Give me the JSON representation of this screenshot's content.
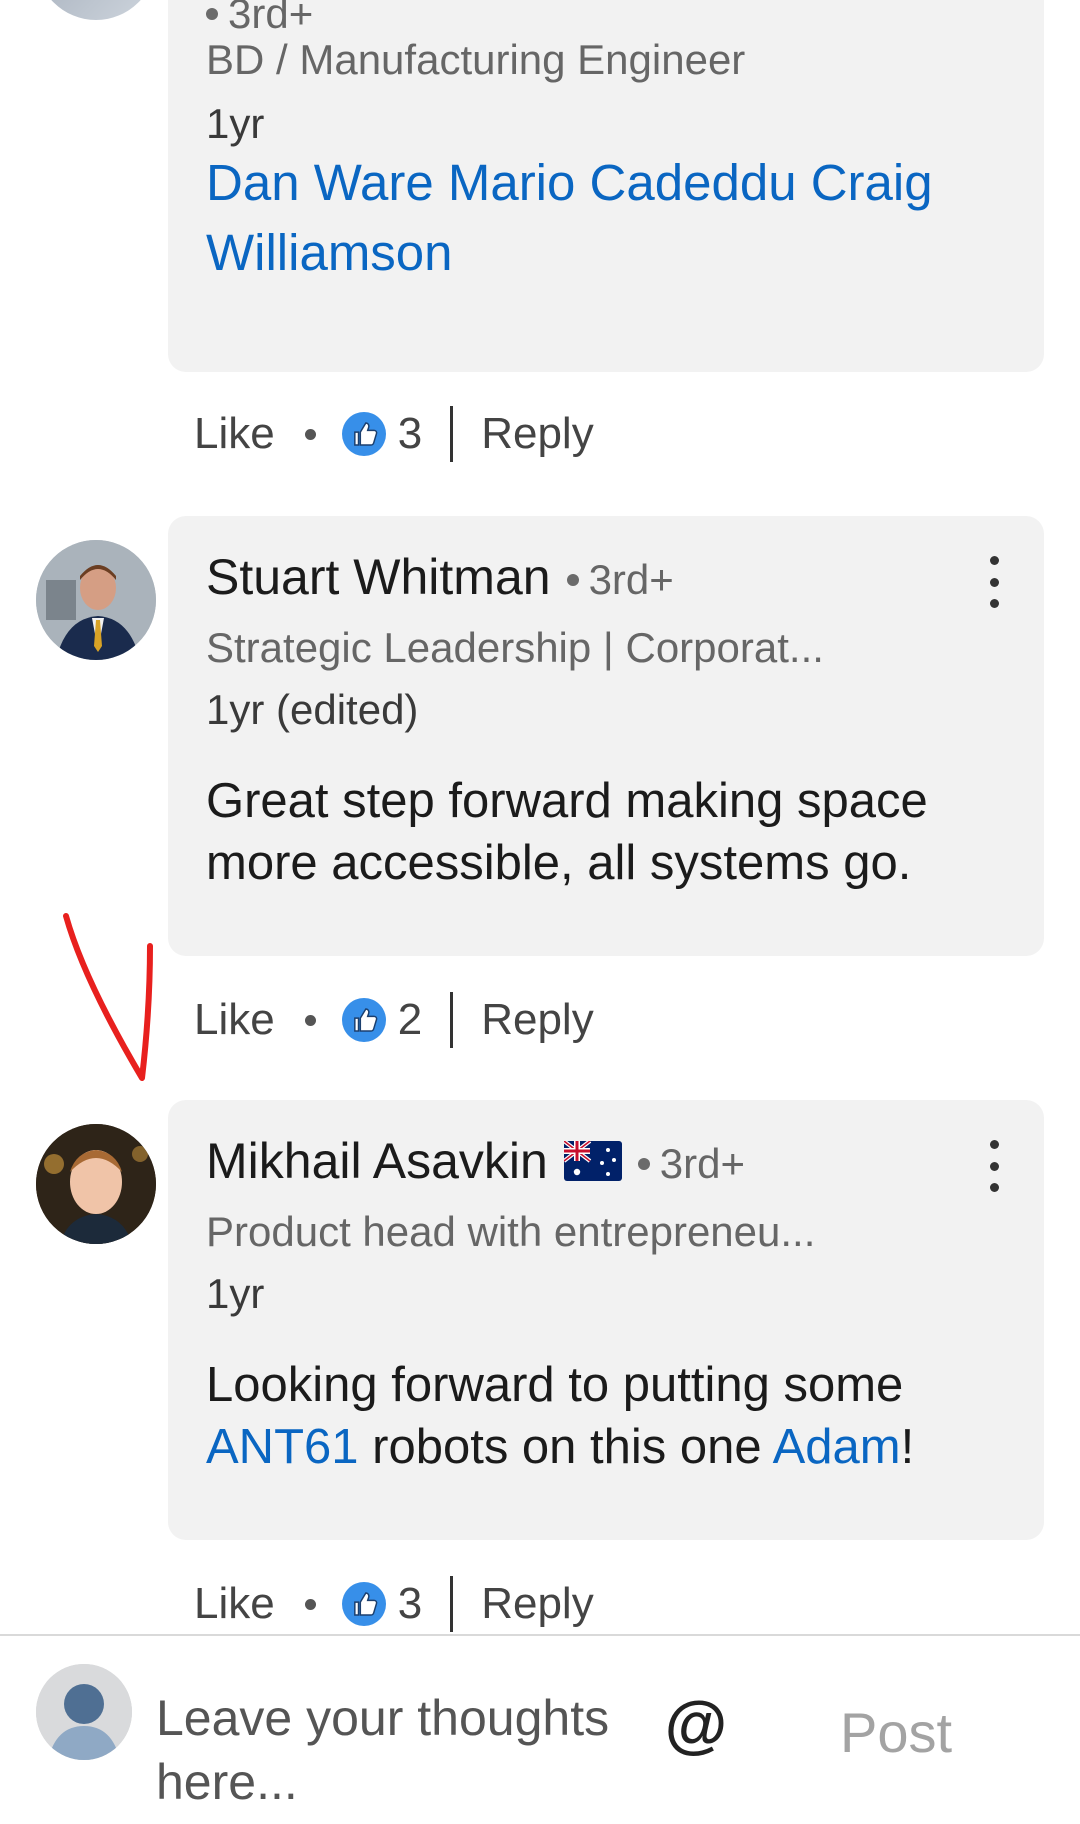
{
  "comments": [
    {
      "degree": "3rd+",
      "headline": "BD / Manufacturing Engineer",
      "time": "1yr",
      "mentions": "Dan Ware Mario Cadeddu Craig Williamson",
      "actions": {
        "like": "Like",
        "count": "3",
        "reply": "Reply"
      }
    },
    {
      "name": "Stuart Whitman",
      "degree": "3rd+",
      "headline": "Strategic Leadership | Corporat...",
      "time": "1yr (edited)",
      "text": "Great step forward making space more accessible, all systems go.",
      "actions": {
        "like": "Like",
        "count": "2",
        "reply": "Reply"
      }
    },
    {
      "name": "Mikhail Asavkin",
      "degree": "3rd+",
      "headline": "Product head with entrepreneu...",
      "time": "1yr",
      "text_parts": [
        "ANT61",
        " robots on this one ",
        "Adam",
        "!"
      ],
      "text_prefix": "Looking forward to putting some ",
      "actions": {
        "like": "Like",
        "count": "3",
        "reply": "Reply"
      }
    }
  ],
  "composer": {
    "placeholder": "Leave your thoughts here...",
    "mention_symbol": "@",
    "post_label": "Post"
  },
  "colors": {
    "link": "#0a66c2",
    "bubble": "#f2f2f2",
    "annotation_arrow": "#e8201e",
    "like_icon": "#378fe9"
  },
  "icons": [
    "like-icon",
    "more-options-icon",
    "australia-flag-icon",
    "at-sign-icon",
    "default-avatar-icon"
  ]
}
